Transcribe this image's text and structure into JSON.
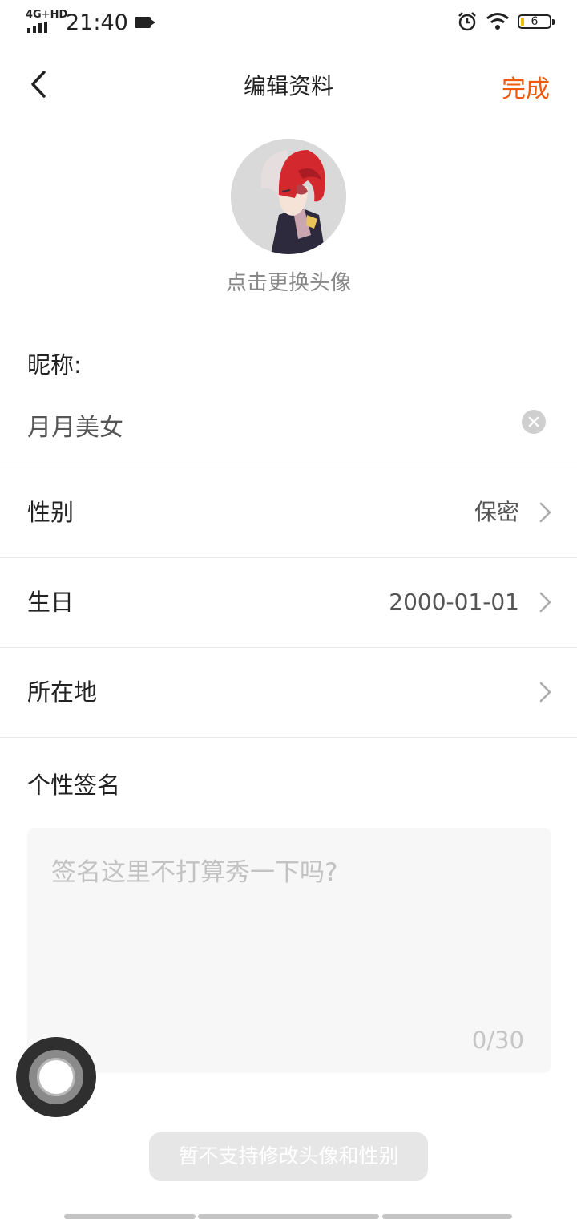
{
  "status_bar": {
    "network": "4G+HD",
    "time": "21:40",
    "battery_level": "6"
  },
  "header": {
    "title": "编辑资料",
    "done_label": "完成"
  },
  "avatar": {
    "hint": "点击更换头像"
  },
  "nickname": {
    "label": "昵称:",
    "value": "月月美女"
  },
  "rows": [
    {
      "label": "性别",
      "value": "保密"
    },
    {
      "label": "生日",
      "value": "2000-01-01"
    },
    {
      "label": "所在地",
      "value": ""
    }
  ],
  "signature": {
    "label": "个性签名",
    "placeholder": "签名这里不打算秀一下吗?",
    "count": "0/30"
  },
  "toast": {
    "text": "暂不支持修改头像和性别"
  },
  "colors": {
    "accent": "#f05a0a"
  }
}
